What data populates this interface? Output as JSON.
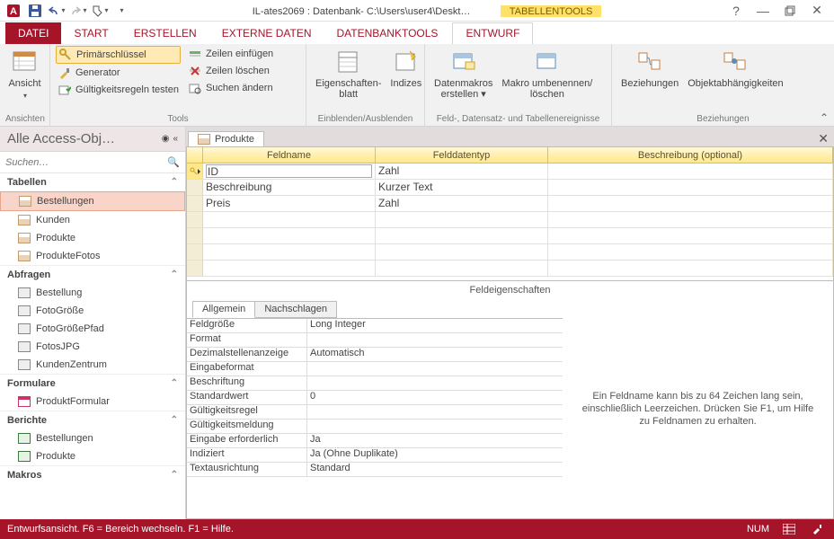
{
  "title_bar": {
    "app_title": "IL-ates2069 : Datenbank- C:\\Users\\user4\\Deskt…",
    "context_tool": "TABELLENTOOLS"
  },
  "tabs": {
    "file": "DATEI",
    "start": "START",
    "erstellen": "ERSTELLEN",
    "externe": "EXTERNE DATEN",
    "dbtools": "DATENBANKTOOLS",
    "entwurf": "ENTWURF"
  },
  "ribbon": {
    "ansicht": "Ansicht",
    "ansichten": "Ansichten",
    "primaerschluessel": "Primärschlüssel",
    "generator": "Generator",
    "gueltigkeit": "Gültigkeitsregeln testen",
    "zeilen_einf": "Zeilen einfügen",
    "zeilen_loesch": "Zeilen löschen",
    "suchen_aendern": "Suchen ändern",
    "tools": "Tools",
    "eigenschaftenblatt": "Eigenschaften-\nblatt",
    "indizes": "Indizes",
    "einblenden": "Einblenden/Ausblenden",
    "datenmakros": "Datenmakros\nerstellen ▾",
    "makro_umb": "Makro umbenennen/\nlöschen",
    "feld_ereignisse": "Feld-, Datensatz- und Tabellenereignisse",
    "beziehungen": "Beziehungen",
    "objektabh": "Objektabhängigkeiten",
    "beziehungen_grp": "Beziehungen"
  },
  "nav": {
    "title": "Alle Access-Obj…",
    "search_placeholder": "Suchen…",
    "groups": {
      "tabellen": "Tabellen",
      "abfragen": "Abfragen",
      "formulare": "Formulare",
      "berichte": "Berichte",
      "makros": "Makros"
    },
    "tabellen_items": [
      "Bestellungen",
      "Kunden",
      "Produkte",
      "ProdukteFotos"
    ],
    "abfragen_items": [
      "Bestellung",
      "FotoGröße",
      "FotoGrößePfad",
      "FotosJPG",
      "KundenZentrum"
    ],
    "formulare_items": [
      "ProduktFormular"
    ],
    "berichte_items": [
      "Bestellungen",
      "Produkte"
    ]
  },
  "doc": {
    "tab": "Produkte",
    "headers": {
      "feldname": "Feldname",
      "datentyp": "Felddatentyp",
      "beschreibung": "Beschreibung (optional)"
    },
    "rows": [
      {
        "name": "ID",
        "type": "Zahl",
        "desc": ""
      },
      {
        "name": "Beschreibung",
        "type": "Kurzer Text",
        "desc": ""
      },
      {
        "name": "Preis",
        "type": "Zahl",
        "desc": ""
      }
    ],
    "props_label": "Feldeigenschaften"
  },
  "props": {
    "tabs": {
      "allgemein": "Allgemein",
      "nachschlagen": "Nachschlagen"
    },
    "rows": [
      {
        "l": "Feldgröße",
        "v": "Long Integer"
      },
      {
        "l": "Format",
        "v": ""
      },
      {
        "l": "Dezimalstellenanzeige",
        "v": "Automatisch"
      },
      {
        "l": "Eingabeformat",
        "v": ""
      },
      {
        "l": "Beschriftung",
        "v": ""
      },
      {
        "l": "Standardwert",
        "v": "0"
      },
      {
        "l": "Gültigkeitsregel",
        "v": ""
      },
      {
        "l": "Gültigkeitsmeldung",
        "v": ""
      },
      {
        "l": "Eingabe erforderlich",
        "v": "Ja"
      },
      {
        "l": "Indiziert",
        "v": "Ja (Ohne Duplikate)"
      },
      {
        "l": "Textausrichtung",
        "v": "Standard"
      }
    ],
    "help": "Ein Feldname kann bis zu 64 Zeichen lang sein, einschließlich Leerzeichen. Drücken Sie F1, um Hilfe zu Feldnamen zu erhalten."
  },
  "status": {
    "left": "Entwurfsansicht. F6 = Bereich wechseln. F1 = Hilfe.",
    "num": "NUM"
  }
}
